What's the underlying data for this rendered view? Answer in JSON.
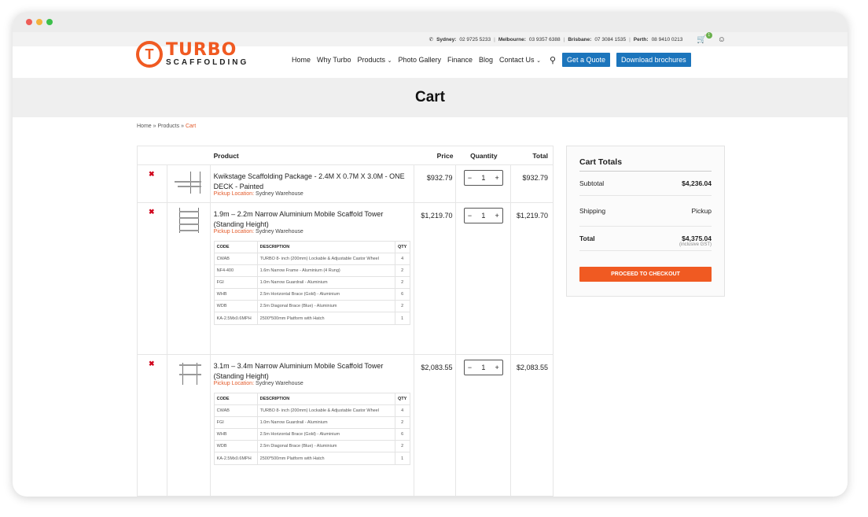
{
  "topbar": {
    "contacts": [
      {
        "city": "Sydney:",
        "phone": "02 9725 5233"
      },
      {
        "city": "Melbourne:",
        "phone": "03 9357 6388"
      },
      {
        "city": "Brisbane:",
        "phone": "07 3084 1535"
      },
      {
        "city": "Perth:",
        "phone": "08 9410 0213"
      }
    ],
    "cart_count": "1"
  },
  "logo": {
    "brand": "TURBO",
    "sub": "SCAFFOLDING",
    "mark": "T"
  },
  "nav": {
    "items": [
      "Home",
      "Why Turbo",
      "Products",
      "Photo Gallery",
      "Finance",
      "Blog",
      "Contact Us"
    ],
    "quote_button": "Get a Quote",
    "brochure_button": "Download brochures"
  },
  "page": {
    "title": "Cart"
  },
  "breadcrumb": {
    "home": "Home",
    "products": "Products",
    "current": "Cart",
    "sep": "»"
  },
  "table": {
    "headers": {
      "product": "Product",
      "price": "Price",
      "quantity": "Quantity",
      "total": "Total"
    },
    "items": [
      {
        "name": "Kwikstage Scaffolding Package - 2.4M X 0.7M X 3.0M - ONE DECK - Painted",
        "pickup_label": "Pickup Location:",
        "pickup": "Sydney Warehouse",
        "price": "$932.79",
        "qty": "1",
        "total": "$932.79"
      },
      {
        "name": "1.9m – 2.2m Narrow Aluminium Mobile Scaffold Tower (Standing Height)",
        "pickup_label": "Pickup Location:",
        "pickup": "Sydney Warehouse",
        "price": "$1,219.70",
        "qty": "1",
        "total": "$1,219.70",
        "components": [
          {
            "code": "CWAB",
            "desc": "TURBO 8- inch (200mm) Lockable & Adjustable Castor Wheel",
            "qty": "4"
          },
          {
            "code": "NF4-400",
            "desc": "1.6m Narrow Frame - Aluminium (4 Rung)",
            "qty": "2"
          },
          {
            "code": "FGI",
            "desc": "1.0m Narrow Guardrail - Aluminium",
            "qty": "2"
          },
          {
            "code": "WHB",
            "desc": "2.5m Horizontal Brace (Gold) - Aluminium",
            "qty": "6"
          },
          {
            "code": "WDB",
            "desc": "2.5m Diagonal Brace (Blue) - Aluminium",
            "qty": "2"
          },
          {
            "code": "KA-2.5Mx0.6MPH",
            "desc": "2500*500mm Platform with Hatch",
            "qty": "1"
          }
        ]
      },
      {
        "name": "3.1m – 3.4m Narrow Aluminium Mobile Scaffold Tower (Standing Height)",
        "pickup_label": "Pickup Location:",
        "pickup": "Sydney Warehouse",
        "price": "$2,083.55",
        "qty": "1",
        "total": "$2,083.55",
        "components": [
          {
            "code": "CWAB",
            "desc": "TURBO 8- inch (200mm) Lockable & Adjustable Castor Wheel",
            "qty": "4"
          },
          {
            "code": "FGI",
            "desc": "1.0m Narrow Guardrail - Aluminium",
            "qty": "2"
          },
          {
            "code": "WHB",
            "desc": "2.5m Horizontal Brace (Gold) - Aluminium",
            "qty": "6"
          },
          {
            "code": "WDB",
            "desc": "2.5m Diagonal Brace (Blue) - Aluminium",
            "qty": "2"
          },
          {
            "code": "KA-2.5Mx0.6MPH",
            "desc": "2500*500mm Platform with Hatch",
            "qty": "1"
          }
        ]
      }
    ],
    "comp_headers": {
      "code": "CODE",
      "desc": "DESCRIPTION",
      "qty": "QTY"
    }
  },
  "totals": {
    "title": "Cart Totals",
    "subtotal_label": "Subtotal",
    "subtotal": "$4,236.04",
    "shipping_label": "Shipping",
    "shipping": "Pickup",
    "total_label": "Total",
    "total": "$4,375.04",
    "gst_note": "(inclusive GST)",
    "checkout_button": "PROCEED TO CHECKOUT"
  },
  "colors": {
    "accent": "#f05a22",
    "primary_button": "#1c75bc",
    "remove": "#d0021b"
  }
}
